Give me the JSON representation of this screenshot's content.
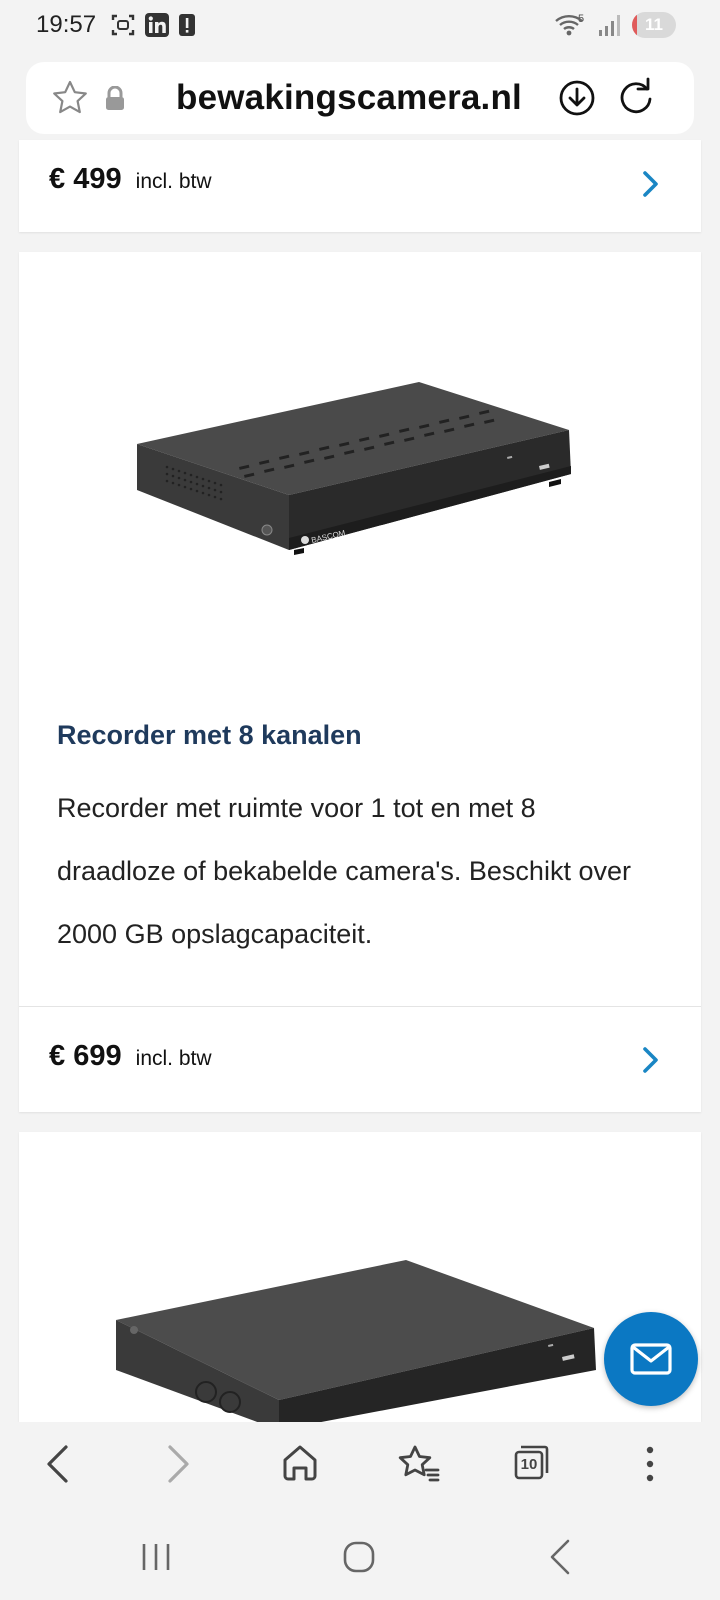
{
  "status_bar": {
    "time": "19:57",
    "battery_level": "11",
    "battery_fraction": 0.11,
    "wifi_badge": "5",
    "left_icons": [
      "screenshot-icon",
      "linkedin-icon",
      "alert-icon"
    ],
    "right_icons": [
      "wifi-icon",
      "signal-icon",
      "battery-icon"
    ]
  },
  "url_bar": {
    "url": "bewakingscamera.nl",
    "icons": [
      "star-icon",
      "lock-icon",
      "download-icon",
      "reload-icon"
    ]
  },
  "cards": [
    {
      "price_symbol": "€",
      "price_value": "499",
      "price_suffix": "incl. btw"
    },
    {
      "title": "Recorder met 8 kanalen",
      "description": "Recorder met ruimte voor 1 tot en met 8 draadloze of bekabelde camera's. Beschikt over 2000 GB opslagcapaciteit.",
      "brand": "BASCOM",
      "price_symbol": "€",
      "price_value": "699",
      "price_suffix": "incl. btw"
    }
  ],
  "fab": {
    "icon": "mail-icon"
  },
  "browser_nav": {
    "items": [
      "back-icon",
      "forward-icon",
      "home-icon",
      "bookmarks-icon",
      "tabs-icon",
      "more-icon"
    ],
    "tab_count": "10"
  },
  "system_nav": {
    "items": [
      "recents-icon",
      "home-circle-icon",
      "system-back-icon"
    ]
  },
  "colors": {
    "accent": "#0b78c3",
    "title": "#1f3a5c",
    "chevron": "#1a86c4"
  }
}
